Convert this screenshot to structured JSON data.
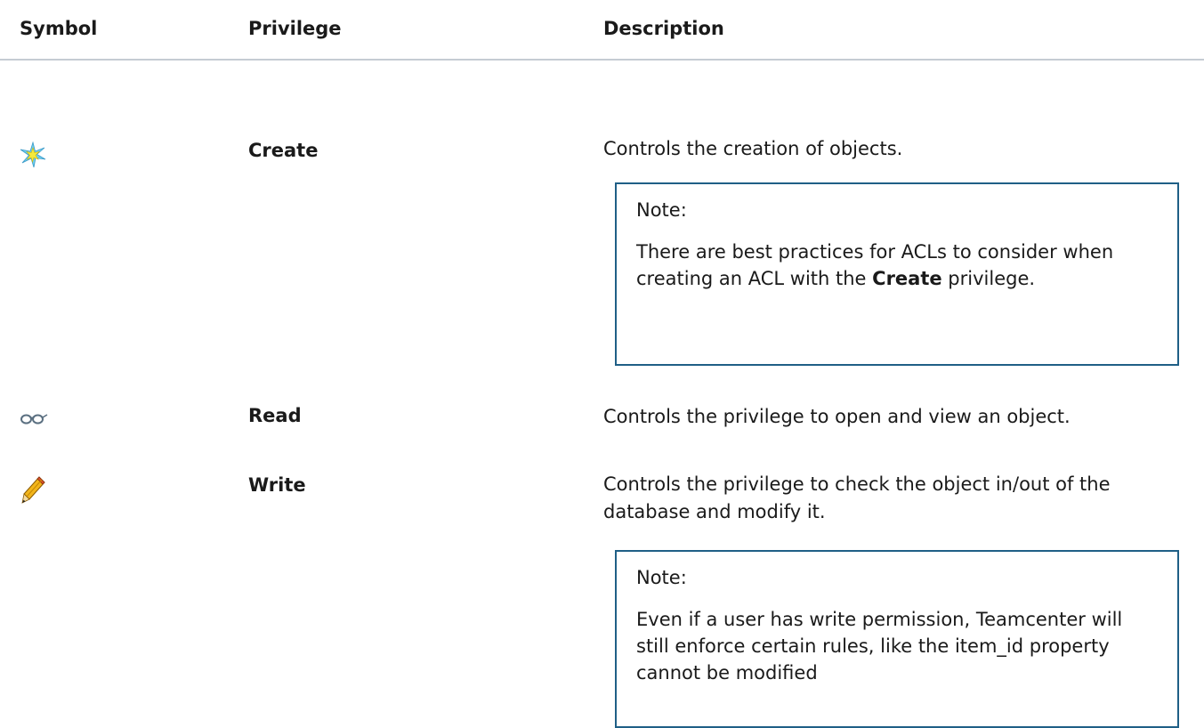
{
  "table": {
    "headers": {
      "symbol": "Symbol",
      "privilege": "Privilege",
      "description": "Description"
    },
    "rows": [
      {
        "icon": "create-star-icon",
        "privilege": "Create",
        "description": "Controls the creation of objects.",
        "note": {
          "title": "Note:",
          "text_before": "There are best practices for ACLs to consider when creating an ACL with the ",
          "bold": "Create",
          "text_after": " privilege."
        }
      },
      {
        "icon": "read-glasses-icon",
        "privilege": "Read",
        "description": "Controls the privilege to open and view an object."
      },
      {
        "icon": "write-pencil-icon",
        "privilege": "Write",
        "description": "Controls the privilege to check the object in/out of the database and modify it.",
        "note": {
          "title": "Note:",
          "text": "Even if a user has write permission, Teamcenter will still enforce certain rules, like the item_id property cannot be modified"
        }
      }
    ]
  },
  "colors": {
    "header_rule": "#c5ccd3",
    "note_border": "#1f5f86",
    "text": "#1a1a1a"
  }
}
